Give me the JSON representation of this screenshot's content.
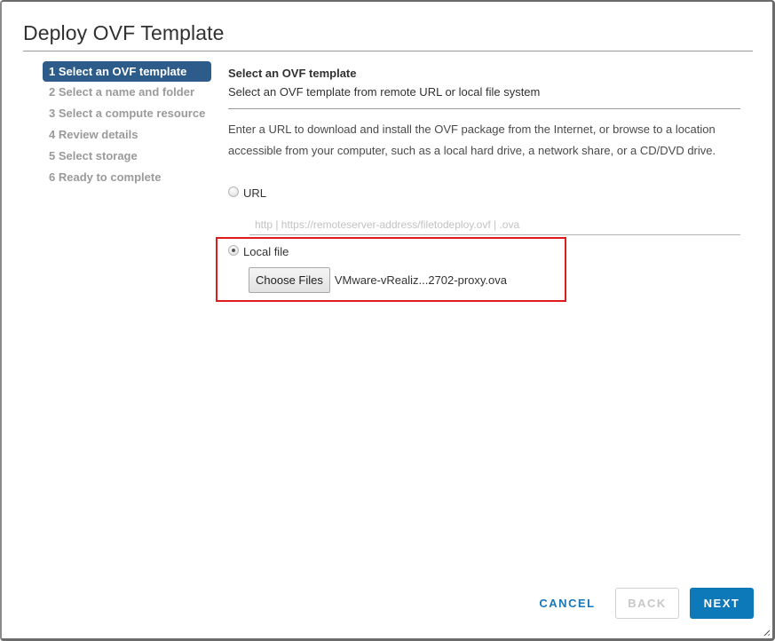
{
  "dialog": {
    "title": "Deploy OVF Template"
  },
  "steps": [
    {
      "label": "1 Select an OVF template",
      "active": true
    },
    {
      "label": "2 Select a name and folder",
      "active": false
    },
    {
      "label": "3 Select a compute resource",
      "active": false
    },
    {
      "label": "4 Review details",
      "active": false
    },
    {
      "label": "5 Select storage",
      "active": false
    },
    {
      "label": "6 Ready to complete",
      "active": false
    }
  ],
  "content": {
    "title": "Select an OVF template",
    "subtitle": "Select an OVF template from remote URL or local file system",
    "description": "Enter a URL to download and install the OVF package from the Internet, or browse to a location accessible from your computer, such as a local hard drive, a network share, or a CD/DVD drive.",
    "source_options": {
      "url": {
        "label": "URL",
        "selected": false
      },
      "local_file": {
        "label": "Local file",
        "selected": true
      }
    },
    "url_input": {
      "value": "",
      "placeholder": "http | https://remoteserver-address/filetodeploy.ovf | .ova"
    },
    "file_picker": {
      "button_label": "Choose Files",
      "selected_file": "VMware-vRealiz...2702-proxy.ova"
    }
  },
  "footer": {
    "cancel_label": "CANCEL",
    "back_label": "BACK",
    "back_enabled": false,
    "next_label": "NEXT"
  },
  "colors": {
    "active_step_bg": "#2d5c8b",
    "primary_button": "#0e79b9",
    "link_blue": "#1a78b8",
    "highlight_red": "#e01b1b"
  }
}
